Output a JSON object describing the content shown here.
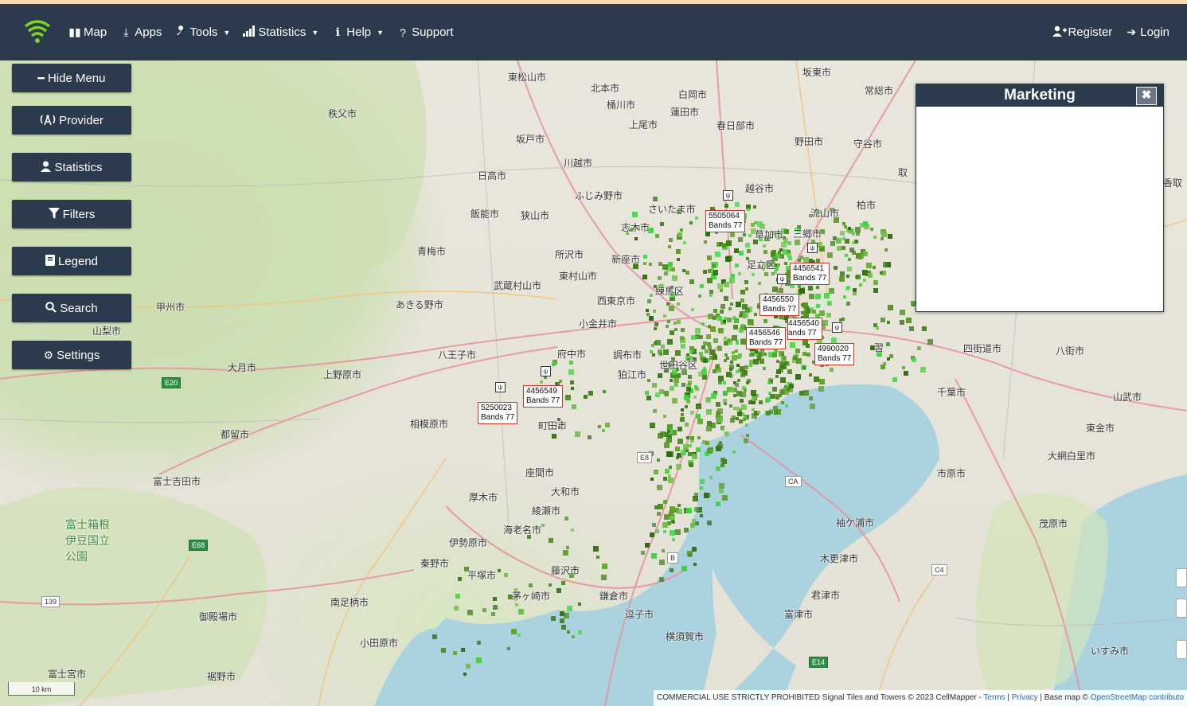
{
  "nav": {
    "left": [
      {
        "icon": "map-icon",
        "glyph": "▮▮",
        "label": "Map",
        "dropdown": false
      },
      {
        "icon": "download-icon",
        "glyph": "⤓",
        "label": "Apps",
        "dropdown": false
      },
      {
        "icon": "wrench-icon",
        "glyph": "🔧",
        "label": "Tools",
        "dropdown": true
      },
      {
        "icon": "signal-icon",
        "glyph": "▁▂▃▅",
        "label": "Statistics",
        "dropdown": true
      },
      {
        "icon": "info-icon",
        "glyph": "ℹ",
        "label": "Help",
        "dropdown": true
      },
      {
        "icon": "question-icon",
        "glyph": "?",
        "label": "Support",
        "dropdown": false
      }
    ],
    "right": [
      {
        "icon": "user-plus-icon",
        "glyph": "👤",
        "label": "Register"
      },
      {
        "icon": "login-icon",
        "glyph": "➔",
        "label": "Login"
      }
    ]
  },
  "side_menu": [
    {
      "name": "hide-menu-button",
      "icon": "minus-icon",
      "glyph": "━",
      "label": "Hide Menu"
    },
    {
      "name": "provider-button",
      "icon": "tower-icon",
      "glyph": "(Ἀ)",
      "label": "Provider"
    },
    {
      "name": "statistics-button",
      "icon": "user-icon",
      "glyph": "👤",
      "label": "Statistics"
    },
    {
      "name": "filters-button",
      "icon": "filter-icon",
      "glyph": "▼",
      "label": "Filters"
    },
    {
      "name": "legend-button",
      "icon": "book-icon",
      "glyph": "▤",
      "label": "Legend"
    },
    {
      "name": "search-button",
      "icon": "search-icon",
      "glyph": "🔍",
      "label": "Search"
    },
    {
      "name": "settings-button",
      "icon": "gear-icon",
      "glyph": "⚙",
      "label": "Settings"
    }
  ],
  "marketing": {
    "title": "Marketing",
    "close_glyph": "✖"
  },
  "towers": [
    {
      "id": "5505064",
      "bands": "Bands 77"
    },
    {
      "id": "4456541",
      "bands": "Bands 77"
    },
    {
      "id": "4456550",
      "bands": "Bands 77"
    },
    {
      "id": "4456540",
      "bands": "ands 77"
    },
    {
      "id": "4456546",
      "bands": "Bands 77"
    },
    {
      "id": "4990020",
      "bands": "Bands 77"
    },
    {
      "id": "4456549",
      "bands": "Bands 77"
    },
    {
      "id": "5250023",
      "bands": "Bands 77"
    }
  ],
  "places": [
    "秩父市",
    "東松山市",
    "北本市",
    "桶川市",
    "上尾市",
    "蓮田市",
    "白岡市",
    "春日部市",
    "坂東市",
    "常総市",
    "坂戸市",
    "川越市",
    "日高市",
    "ふじみ野市",
    "飯能市",
    "狭山市",
    "志木市",
    "さいたま市",
    "草加市",
    "三郷市",
    "流山市",
    "越谷市",
    "野田市",
    "守谷市",
    "柏市",
    "青梅市",
    "所沢市",
    "新座市",
    "東村山市",
    "武蔵村山市",
    "あきる野市",
    "西東京市",
    "練馬区",
    "足立区",
    "甲州市",
    "小金井市",
    "府中市",
    "調布市",
    "狛江市",
    "世田谷区",
    "八王子市",
    "山梨市",
    "大月市",
    "上野原市",
    "相模原市",
    "町田市",
    "都留市",
    "富士吉田市",
    "座間市",
    "大和市",
    "厚木市",
    "綾瀬市",
    "海老名市",
    "伊勢原市",
    "秦野市",
    "平塚市",
    "藤沢市",
    "茅ヶ崎市",
    "鎌倉市",
    "逗子市",
    "横須賀市",
    "南足柄市",
    "小田原市",
    "御殿場市",
    "裾野市",
    "富士宮市",
    "四街道市",
    "八街市",
    "千葉市",
    "山武市",
    "東金市",
    "大網白里市",
    "市原市",
    "袖ケ浦市",
    "木更津市",
    "君津市",
    "富津市",
    "茂原市",
    "いすみ市",
    "取",
    "香取",
    "習"
  ],
  "park_label": "富士箱根\n伊豆国立\n公園",
  "road_shields": [
    "E20",
    "E68",
    "139",
    "E14",
    "CA",
    "C4",
    "B",
    "E8"
  ],
  "scale": "10 km",
  "attribution": {
    "text": "COMMERCIAL USE STRICTLY PROHIBITED Signal Tiles and Towers © 2023 CellMapper - ",
    "terms": "Terms",
    "sep1": " | ",
    "privacy": "Privacy",
    "sep2": " | Base map © ",
    "osm": "OpenStreetMap contributo"
  }
}
